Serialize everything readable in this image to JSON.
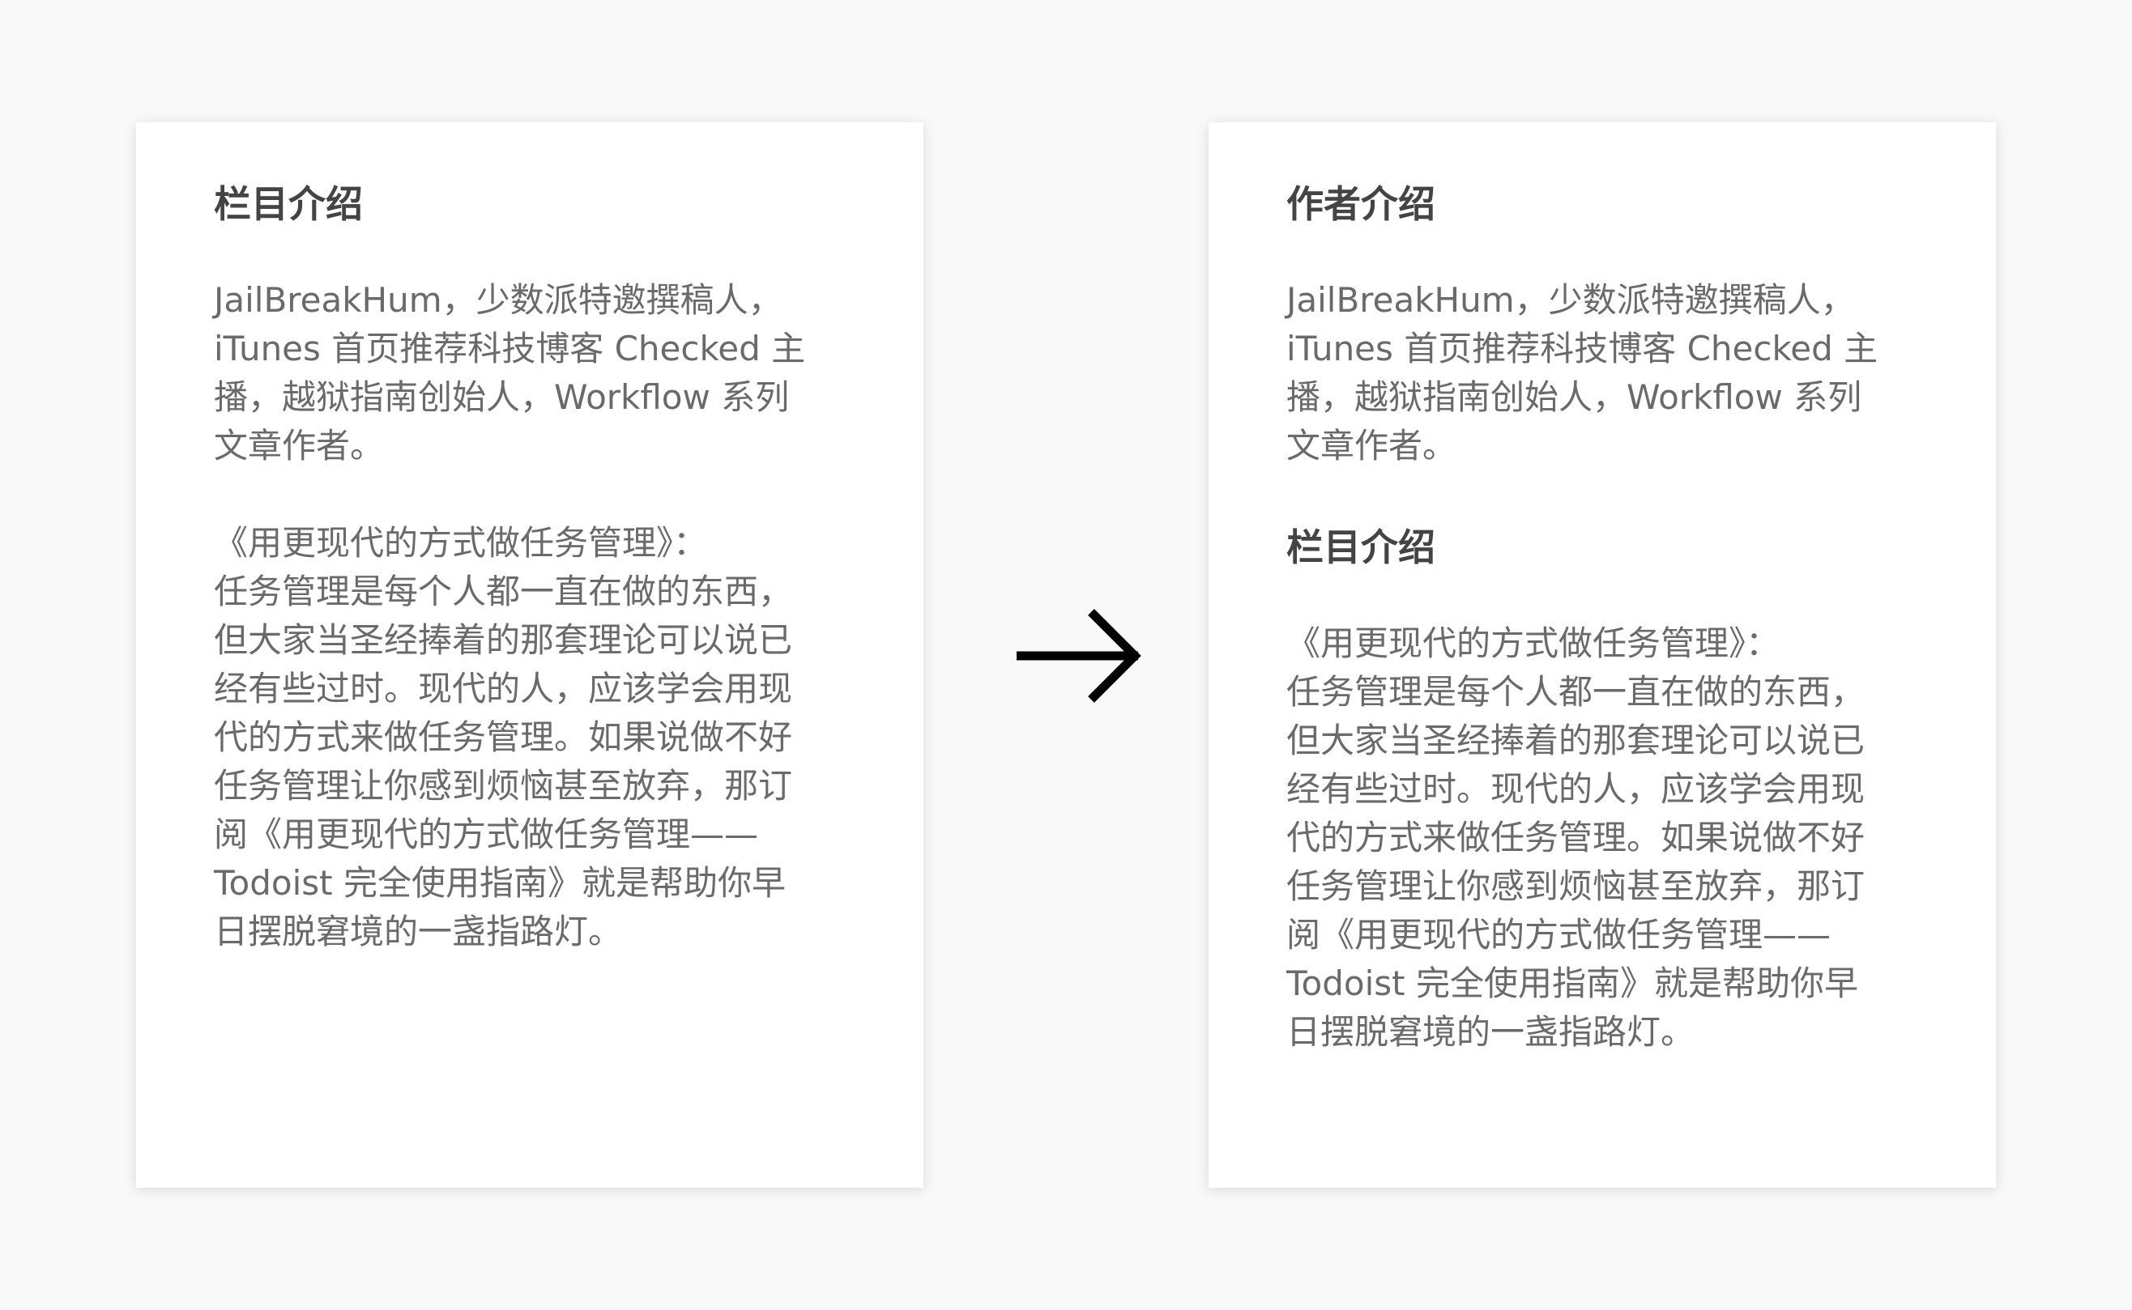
{
  "left_card": {
    "heading": "栏目介绍",
    "author_text": "JailBreakHum，少数派特邀撰稿人，\niTunes 首页推荐科技博客 Checked 主\n播，越狱指南创始人，Workflow 系列\n文章作者。",
    "column_text": "《用更现代的方式做任务管理》：\n任务管理是每个人都一直在做的东西，\n但大家当圣经捧着的那套理论可以说已\n经有些过时。现代的人，应该学会用现\n代的方式来做任务管理。如果说做不好\n任务管理让你感到烦恼甚至放弃，那订\n阅《用更现代的方式做任务管理——\nTodoist 完全使用指南》就是帮助你早\n日摆脱窘境的一盏指路灯。"
  },
  "arrow": {
    "icon": "arrow-right-icon",
    "color": "#000000"
  },
  "right_card": {
    "author_heading": "作者介绍",
    "author_text": "JailBreakHum，少数派特邀撰稿人，\niTunes 首页推荐科技博客 Checked 主\n播，越狱指南创始人，Workflow 系列\n文章作者。",
    "column_heading": "栏目介绍",
    "column_text": "《用更现代的方式做任务管理》：\n任务管理是每个人都一直在做的东西，\n但大家当圣经捧着的那套理论可以说已\n经有些过时。现代的人，应该学会用现\n代的方式来做任务管理。如果说做不好\n任务管理让你感到烦恼甚至放弃，那订\n阅《用更现代的方式做任务管理——\nTodoist 完全使用指南》就是帮助你早\n日摆脱窘境的一盏指路灯。"
  }
}
